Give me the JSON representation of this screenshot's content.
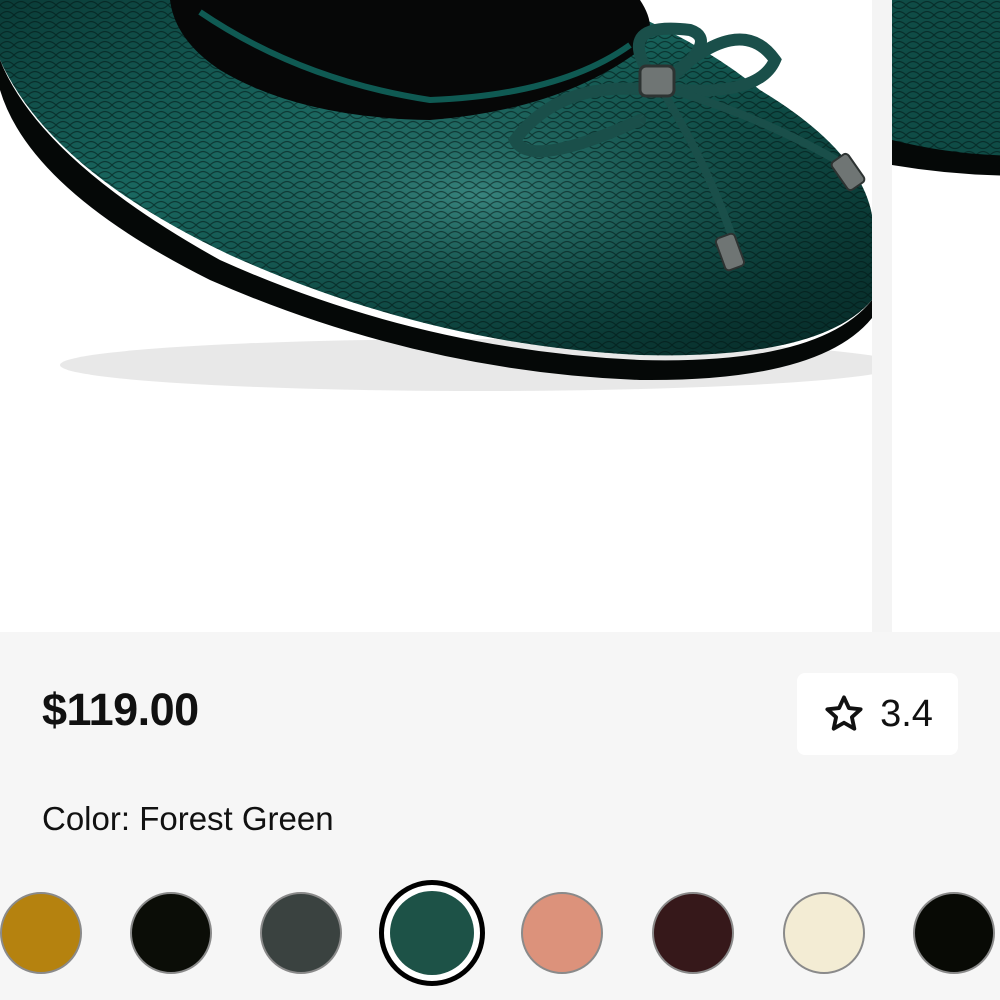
{
  "product": {
    "price": "$119.00",
    "rating": "3.4",
    "color_prefix": "Color:",
    "selected_color": "Forest Green",
    "image_alt": "Forest Green snake-embossed ballet flat with bow"
  },
  "swatches": [
    {
      "name": "mustard",
      "color": "#B5820F",
      "selected": false
    },
    {
      "name": "black",
      "color": "#0B0D07",
      "selected": false
    },
    {
      "name": "charcoal",
      "color": "#3A4240",
      "selected": false
    },
    {
      "name": "forest-green",
      "color": "#1D5247",
      "selected": true
    },
    {
      "name": "blush",
      "color": "#DC927B",
      "selected": false
    },
    {
      "name": "burgundy",
      "color": "#36181A",
      "selected": false
    },
    {
      "name": "cream",
      "color": "#F3ECD4",
      "selected": false
    },
    {
      "name": "black-2",
      "color": "#080A05",
      "selected": false
    }
  ],
  "icons": {
    "rating": "star-outline-icon"
  },
  "colors": {
    "shoe": "#0E4A44",
    "shoe_dark": "#06211F",
    "panel_bg": "#F6F6F6"
  }
}
